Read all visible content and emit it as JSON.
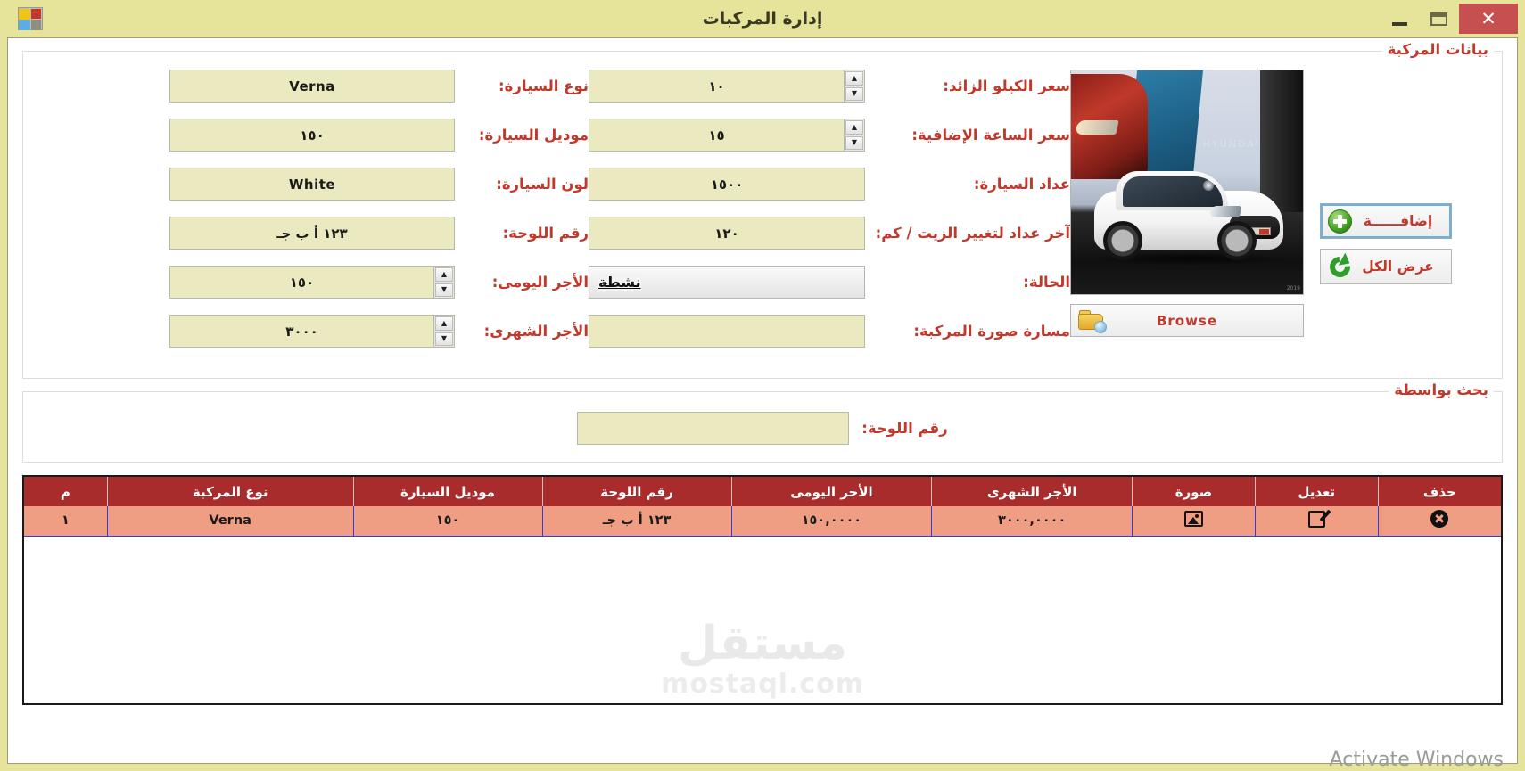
{
  "window": {
    "title": "إدارة المركبات",
    "close_label": "✕",
    "app_icon": "app-window-icon"
  },
  "vehicle_group": {
    "title": "بيانات المركبة",
    "right_fields": [
      {
        "label": "نوع السيارة:",
        "value": "Verna",
        "kind": "text"
      },
      {
        "label": "موديل السيارة:",
        "value": "١٥٠",
        "kind": "text"
      },
      {
        "label": "لون السيارة:",
        "value": "White",
        "kind": "text"
      },
      {
        "label": "رقم اللوحة:",
        "value": "١٢٣ أ ب جـ",
        "kind": "text"
      },
      {
        "label": "الأجر اليومى:",
        "value": "١٥٠",
        "kind": "spinner"
      },
      {
        "label": "الأجر الشهرى:",
        "value": "٣٠٠٠",
        "kind": "spinner"
      }
    ],
    "mid_fields": [
      {
        "label": "سعر الكيلو الزائد:",
        "value": "١٠",
        "kind": "spinner"
      },
      {
        "label": "سعر الساعة الإضافية:",
        "value": "١٥",
        "kind": "spinner"
      },
      {
        "label": "عداد السيارة:",
        "value": "١٥٠٠",
        "kind": "text"
      },
      {
        "label": "آخر عداد لتغيير الزيت / كم:",
        "value": "١٢٠",
        "kind": "text"
      },
      {
        "label": "الحالة:",
        "value": "نشطة",
        "kind": "combo"
      },
      {
        "label": "مسارة صورة المركبة:",
        "value": "",
        "kind": "text"
      }
    ],
    "browse_button": "Browse",
    "buttons": [
      {
        "label": "إضافــــــة",
        "icon": "plus-circle-icon",
        "focused": true
      },
      {
        "label": "عرض الكل",
        "icon": "refresh-icon",
        "focused": false
      }
    ],
    "photo_logo": "HYUNDAI"
  },
  "search_group": {
    "title": "بحث بواسطة",
    "label": "رقم اللوحة:",
    "value": "",
    "placeholder": ""
  },
  "table": {
    "columns": [
      {
        "key": "num",
        "label": "م"
      },
      {
        "key": "type",
        "label": "نوع المركبة"
      },
      {
        "key": "model",
        "label": "موديل السيارة"
      },
      {
        "key": "plate",
        "label": "رقم اللوحة"
      },
      {
        "key": "daily",
        "label": "الأجر اليومى"
      },
      {
        "key": "month",
        "label": "الأجر الشهرى"
      },
      {
        "key": "img",
        "label": "صورة"
      },
      {
        "key": "edit",
        "label": "تعديل"
      },
      {
        "key": "del",
        "label": "حذف"
      }
    ],
    "rows": [
      {
        "num": "١",
        "type": "Verna",
        "model": "١٥٠",
        "plate": "١٢٣ أ ب جـ",
        "daily": "١٥٠,٠٠٠٠",
        "month": "٣٠٠٠,٠٠٠٠",
        "img": "photo-icon",
        "edit": "edit-icon",
        "del": "delete-icon"
      }
    ]
  },
  "watermark": {
    "arabic": "مستقل",
    "latin": "mostaql.com"
  },
  "os_notice": "Activate Windows",
  "colors": {
    "window_chrome": "#e6e49a",
    "accent_red": "#c0392b",
    "table_header": "#a82c2c",
    "table_row": "#ef9e83",
    "field_bg": "#eae9c0"
  }
}
